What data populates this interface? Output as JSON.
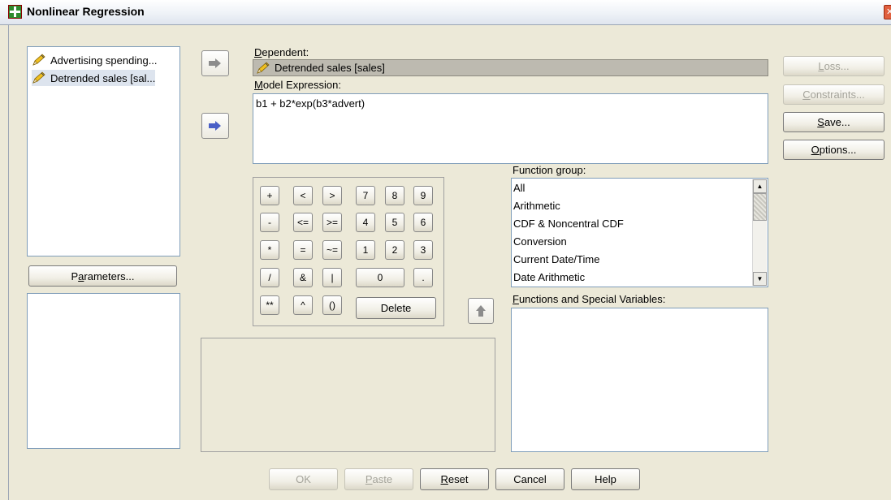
{
  "window": {
    "title": "Nonlinear Regression",
    "close_glyph": "✕"
  },
  "variables": [
    {
      "label": "Advertising spending...",
      "icon": "scale-pencil-icon"
    },
    {
      "label": "Detrended sales [sal...",
      "icon": "scale-pencil-icon"
    }
  ],
  "dependent": {
    "label_u": "D",
    "label_rest": "ependent:",
    "value": "Detrended sales [sales]",
    "icon": "scale-pencil-icon"
  },
  "model_expression": {
    "label_u": "M",
    "label_rest": "odel Expression:",
    "value": "b1 + b2*exp(b3*advert)"
  },
  "parameters_button": {
    "pre": "P",
    "u": "a",
    "post": "rameters..."
  },
  "right_buttons": {
    "loss": {
      "u": "L",
      "rest": "oss..."
    },
    "constraints": {
      "u": "C",
      "rest": "onstraints..."
    },
    "save": {
      "u": "S",
      "rest": "ave..."
    },
    "options": {
      "u": "O",
      "rest": "ptions..."
    }
  },
  "keypad": {
    "ops": [
      [
        "+",
        "<",
        ">"
      ],
      [
        "-",
        "<=",
        ">="
      ],
      [
        "*",
        "=",
        "~="
      ],
      [
        "/",
        "&",
        "|"
      ],
      [
        "**",
        "^",
        "()"
      ]
    ],
    "digits": [
      [
        "7",
        "8",
        "9"
      ],
      [
        "4",
        "5",
        "6"
      ],
      [
        "1",
        "2",
        "3"
      ]
    ],
    "zero": "0",
    "dot": ".",
    "delete": "Delete"
  },
  "function_group": {
    "label_pre": "Function ",
    "label_u": "g",
    "label_post": "roup:",
    "items": [
      "All",
      "Arithmetic",
      "CDF & Noncentral CDF",
      "Conversion",
      "Current Date/Time",
      "Date Arithmetic"
    ]
  },
  "functions_special": {
    "label_u": "F",
    "label_rest": "unctions and Special Variables:"
  },
  "bottom_buttons": {
    "ok": "OK",
    "paste": {
      "u": "P",
      "rest": "aste"
    },
    "reset": {
      "u": "R",
      "rest": "eset"
    },
    "cancel": "Cancel",
    "help": "Help"
  },
  "colors": {
    "active_arrow": "#4a5fc6",
    "inactive_arrow": "#8c8c8c",
    "dialog_bg": "#ece9d8"
  }
}
